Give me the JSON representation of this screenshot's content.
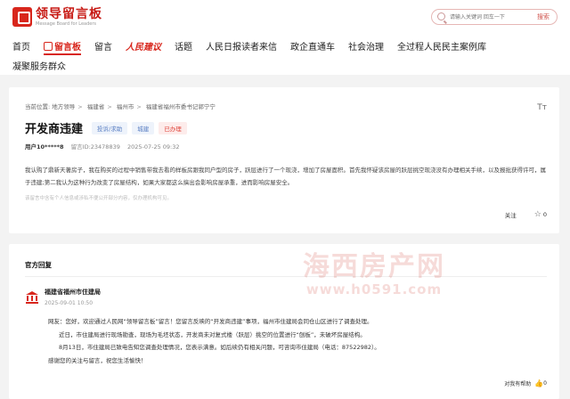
{
  "logo": {
    "title": "领导留言板",
    "subtitle": "Message Board for Leaders"
  },
  "search": {
    "placeholder": "请输入关键词 回车一下",
    "button": "搜索"
  },
  "nav": {
    "row1": [
      "首页",
      "留言板",
      "留言",
      "人民建议",
      "话题",
      "人民日报读者来信",
      "政企直通车",
      "社会治理",
      "全过程人民民主案例库"
    ],
    "row2": [
      "凝聚服务群众"
    ]
  },
  "post": {
    "breadcrumb": [
      "当前位置:",
      "地方领导",
      "福建省",
      "福州市",
      "福建省福州市委书记郭宁宁"
    ],
    "title": "开发商违建",
    "tags": [
      "投诉/求助",
      "城建",
      "已办理"
    ],
    "user": "用户10*****8",
    "message_id": "留言ID:23478839",
    "time": "2025-07-25 09:32",
    "content": "我认购了鼎新天著房子，我在购买的过程中销售带我去看的样板房跟我同户型的房子，跃层进行了一个现浇，增加了房屋面积。首先我怀疑该房屋的跃层挑空现浇没有办理相关手续，以及报批获得许可，属于违建;第二我认为这种行为改变了房屋结构，如果大家都这么搞出会影响房屋承重，进而影响房屋安全。",
    "disclaimer": "该留言中含有个人信息或涉私不便公开部分内容，仅办理机构可见。",
    "follow": "关注",
    "like_count": "0"
  },
  "reply": {
    "heading": "官方回复",
    "watermark": "海西房产网",
    "watermark_url": "www.h0591.com",
    "org": "福建省福州市住建局",
    "time": "2025-09-01 10:50",
    "lines": [
      "网友：您好，欢迎通过人民网“领导留言板”留言！您留言反映的“开发商违建”事项，福州市住建局会同仓山区进行了调查处理。",
      "近日，市住建局进行现场勘查，现场为毛坯状态，开发商未对复式楼（跃层）挑空的位置进行“刨板”，未破坏房屋结构。",
      "8月13日，市住建局已致电告知您调查处理情况，您表示满意。如后续仍有相关问题，可咨询市住建局（电话：87522982）。",
      "感谢您的关注与留言，祝您生活愉快！"
    ],
    "helpful": "对我有帮助",
    "like_count": "0"
  }
}
